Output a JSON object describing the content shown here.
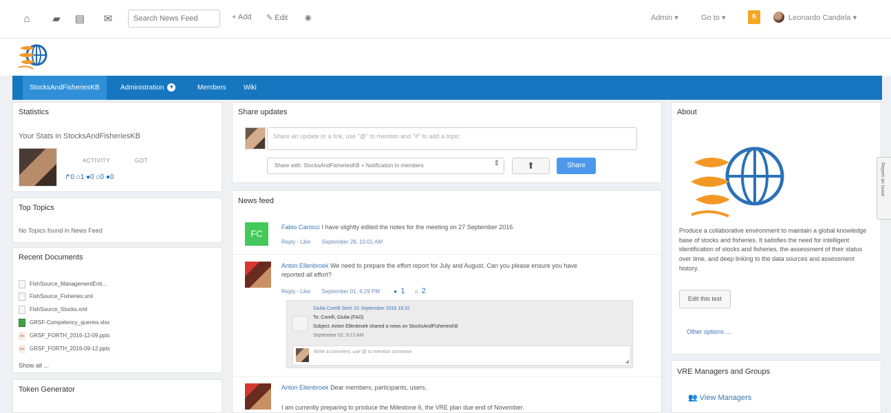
{
  "topbar": {
    "search_placeholder": "Search News Feed",
    "add_label": "+ Add",
    "edit_label": "Edit",
    "admin_label": "Admin",
    "goto_label": "Go to",
    "notification_count": "6",
    "user_name": "Leonardo Candela"
  },
  "nav": {
    "items": [
      "StocksAndFisheriesKB",
      "Administration",
      "Members",
      "Wiki"
    ]
  },
  "statistics": {
    "title": "Statistics",
    "subtitle": "Your Stats in StocksAndFisheriesKB",
    "activity_label": "ACTIVITY",
    "got_label": "GOT",
    "counts_line": "↱0 ⌂1 ●0 ⌂0 ●0"
  },
  "top_topics": {
    "title": "Top Topics",
    "empty_text": "No Topics found in News Feed"
  },
  "recent_documents": {
    "title": "Recent Documents",
    "items": [
      {
        "name": "FishSource_ManagementEnti...",
        "icon": "document-icon"
      },
      {
        "name": "FishSource_Fisheries.xml",
        "icon": "document-icon"
      },
      {
        "name": "FishSource_Stocks.xml",
        "icon": "document-icon"
      },
      {
        "name": "GRSF-Competency_queries.xlsx",
        "icon": "spreadsheet-icon"
      },
      {
        "name": "GRSF_FORTH_2016-12-09.pptx",
        "icon": "presentation-icon"
      },
      {
        "name": "GRSF_FORTH_2016-09-12.pptx",
        "icon": "presentation-icon"
      }
    ],
    "show_all": "Show all ..."
  },
  "token_generator": {
    "title": "Token Generator"
  },
  "share": {
    "title": "Share updates",
    "placeholder": "Share an update or a link, use \"@\" to mention and \"#\" to add a topic",
    "selected_option": "Share with: StocksAndFisheriesKB + Notification to members",
    "share_button": "Share"
  },
  "news_feed": {
    "title": "News feed",
    "posts": [
      {
        "author": "Fabio Carocci",
        "text": "I have slightly edited the notes for the meeting on 27 September 2016",
        "reply": "Reply",
        "like": "Like",
        "date": "September 28, 10:01 AM",
        "avatar_initials": "FC"
      },
      {
        "author": "Anton Ellenbroek",
        "text_line1": "We need to prepare the effort report for July and August. Can you please ensure you have",
        "text_line2": "reported all effort?",
        "reply": "Reply",
        "like": "Like",
        "date": "September 01, 6:29 PM",
        "comments": "1",
        "likes": "2",
        "comment": {
          "author_sent": "Giulia Corelli Sent: 01 September 2016 18:31",
          "to": "To: Corelli, Giulia (FAO)",
          "subject": "Subject: Anton Ellenbroek shared a news on StocksAndFisheriesKB",
          "date": "September 02, 9:12 AM",
          "input_placeholder": "Write a comment, use @ to mention someone"
        }
      },
      {
        "author": "Anton Ellenbroek",
        "text": "Dear members, participants, users,",
        "text_line2": "I am currently preparing to produce the Milestone 6, the VRE plan due end of November."
      }
    ]
  },
  "about": {
    "title": "About",
    "description": "Produce a collaborative environment to maintain a global knowledge base of stocks and fisheries. It satisfies the need for intelligent identification of stocks and fisheries, the assessment of their status over time, and deep linking to the data sources and assessment history.",
    "edit_button": "Edit this text",
    "other_options": "Other options ..."
  },
  "vre_managers": {
    "title": "VRE Managers and Groups",
    "view_managers": "View Managers"
  },
  "report_issue": {
    "label": "Report an Issue"
  }
}
